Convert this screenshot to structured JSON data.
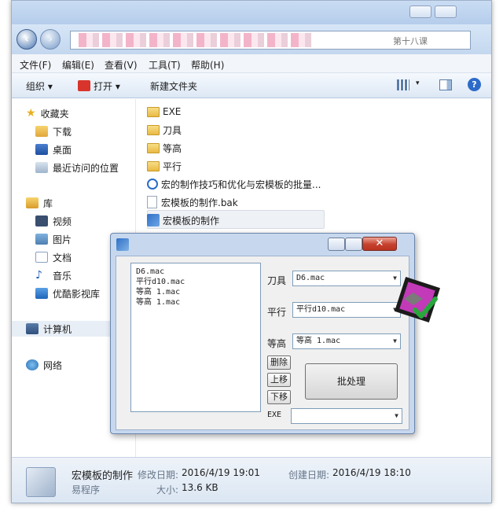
{
  "explorer": {
    "address_tail": "第十八课"
  },
  "menu": {
    "file": "文件(F)",
    "edit": "编辑(E)",
    "view": "查看(V)",
    "tools": "工具(T)",
    "help": "帮助(H)"
  },
  "toolbar": {
    "organize": "组织 ▾",
    "open": "打开 ▾",
    "new_folder": "新建文件夹"
  },
  "nav": {
    "favorites": "收藏夹",
    "downloads": "下载",
    "desktop": "桌面",
    "recent": "最近访问的位置",
    "library": "库",
    "videos": "视频",
    "pictures": "图片",
    "documents": "文档",
    "music": "音乐",
    "youku": "优酷影视库",
    "computer": "计算机",
    "network": "网络"
  },
  "files": [
    {
      "name": "EXE",
      "type": "folder"
    },
    {
      "name": "刀具",
      "type": "folder"
    },
    {
      "name": "等高",
      "type": "folder"
    },
    {
      "name": "平行",
      "type": "folder"
    },
    {
      "name": "宏的制作技巧和优化与宏模板的批量...",
      "type": "video"
    },
    {
      "name": "宏模板的制作.bak",
      "type": "doc"
    },
    {
      "name": "宏模板的制作",
      "type": "app"
    }
  ],
  "details": {
    "name": "宏模板的制作",
    "type": "易程序",
    "modified_label": "修改日期:",
    "modified": "2016/4/19 19:01",
    "created_label": "创建日期:",
    "created": "2016/4/19 18:10",
    "size_label": "大小:",
    "size": "13.6 KB"
  },
  "dialog": {
    "list_items": [
      "D6.mac",
      "平行d10.mac",
      "等高 1.mac",
      "等高 1.mac"
    ],
    "tool_label": "刀具",
    "tool_value": "D6.mac",
    "parallel_label": "平行",
    "parallel_value": "平行d10.mac",
    "contour_label": "等高",
    "contour_value": "等高 1.mac",
    "delete": "删除",
    "move_up": "上移",
    "move_down": "下移",
    "batch": "批处理",
    "exe_label": "EXE",
    "exe_value": ""
  },
  "icons": {
    "back": "back-arrow-icon",
    "forward": "forward-arrow-icon",
    "folder": "folder-icon",
    "close": "close-icon"
  }
}
